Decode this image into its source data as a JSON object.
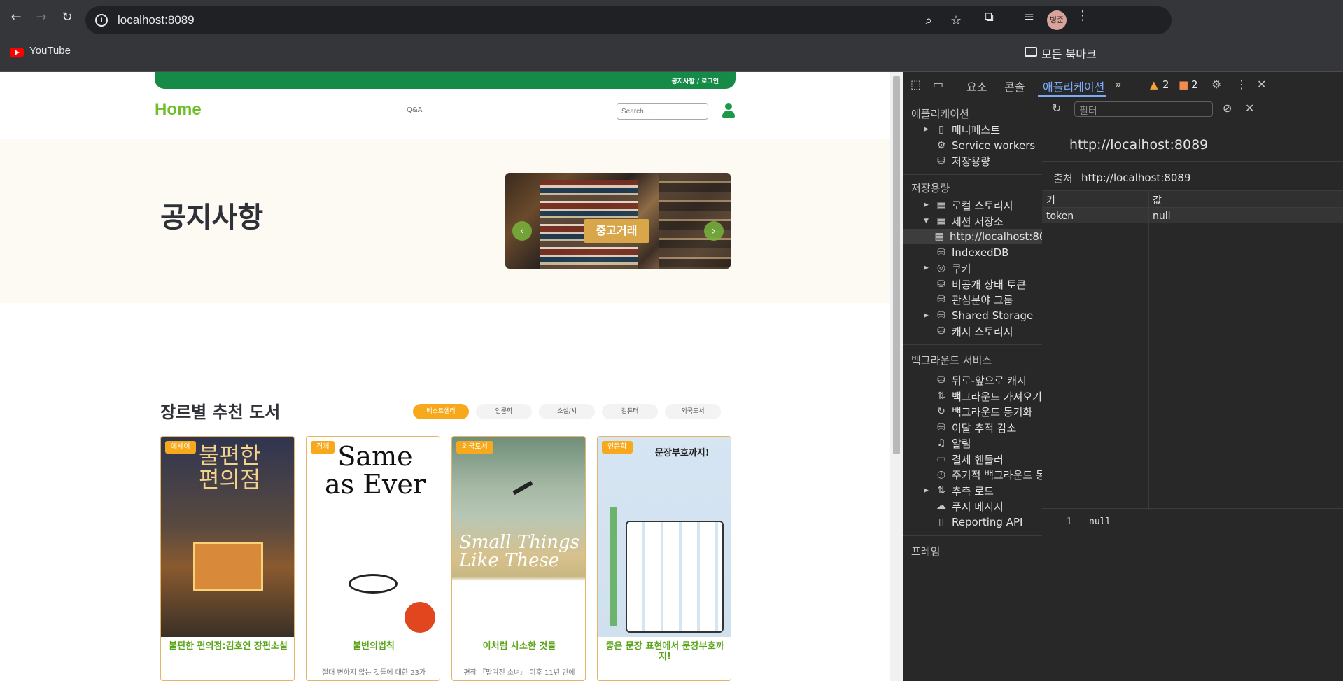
{
  "browser": {
    "url": "localhost:8089",
    "avatar_text": "병준",
    "bookmarks": [
      {
        "label": "YouTube"
      }
    ],
    "all_bookmarks": "모든 북마크"
  },
  "site": {
    "top_links": "공지사항 / 로그인",
    "logo": "Home",
    "nav_qna": "Q&A",
    "search_placeholder": "Search...",
    "hero_title": "공지사항",
    "slide_label": "중고거래",
    "genre_title": "장르별 추천 도서",
    "tabs": [
      {
        "label": "베스트셀러",
        "active": true
      },
      {
        "label": "인문학",
        "active": false
      },
      {
        "label": "소설/시",
        "active": false
      },
      {
        "label": "컴퓨터",
        "active": false
      },
      {
        "label": "외국도서",
        "active": false
      }
    ],
    "books": [
      {
        "badge": "에세이",
        "title": "불편한 편의점:김호연 장편소설",
        "desc": "",
        "cover_text": "불편한 편의점"
      },
      {
        "badge": "경제",
        "title": "불변의법칙",
        "desc": "절대 변하지 않는 것들에 대한 23가",
        "cover_text": "Same as Ever"
      },
      {
        "badge": "외국도서",
        "title": "이처럼 사소한 것들",
        "desc": "편작 『맡겨진 소녀』 이후 11년 만에",
        "cover_text": "Small Things Like These"
      },
      {
        "badge": "인문학",
        "title": "좋은 문장 표현에서 문장부호까지!",
        "desc": "",
        "cover_text": "문장부호까지!"
      }
    ]
  },
  "devtools": {
    "tabs": [
      "요소",
      "콘솔",
      "애플리케이션"
    ],
    "active_tab": "애플리케이션",
    "warnings": "2",
    "errors": "2",
    "sidebar": {
      "sections": [
        {
          "heading": "애플리케이션",
          "items": [
            "매니페스트",
            "Service workers",
            "저장용량"
          ]
        },
        {
          "heading": "저장용량",
          "items": [
            "로컬 스토리지",
            "세션 저장소",
            "http://localhost:80",
            "IndexedDB",
            "쿠키",
            "비공개 상태 토큰",
            "관심분야 그룹",
            "Shared Storage",
            "캐시 스토리지"
          ]
        },
        {
          "heading": "백그라운드 서비스",
          "items": [
            "뒤로-앞으로 캐시",
            "백그라운드 가져오기",
            "백그라운드 동기화",
            "이탈 추적 감소",
            "알림",
            "결제 핸들러",
            "주기적 백그라운드 동기화",
            "추측 로드",
            "푸시 메시지",
            "Reporting API"
          ]
        },
        {
          "heading": "프레임",
          "items": []
        }
      ]
    },
    "filter_placeholder": "필터",
    "origin_title": "http://localhost:8089",
    "origin_label": "출처",
    "origin_value": "http://localhost:8089",
    "table": {
      "headers": [
        "키",
        "값"
      ],
      "rows": [
        {
          "key": "token",
          "value": "null"
        }
      ]
    },
    "preview": {
      "line": "1",
      "value": "null"
    }
  }
}
